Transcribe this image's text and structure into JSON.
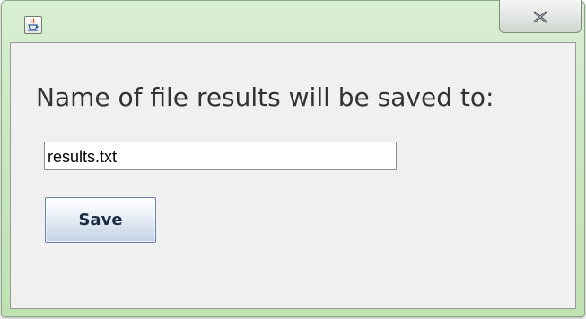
{
  "window": {
    "icon": "java-cup-icon",
    "close_icon": "close-icon",
    "accent": "#c6e6bb"
  },
  "dialog": {
    "prompt": "Name of file results will be saved to:",
    "filename_value": "results.txt",
    "save_label": "Save"
  },
  "colors": {
    "content_background": "#f0f0f0",
    "button_border": "#6d83a8"
  }
}
